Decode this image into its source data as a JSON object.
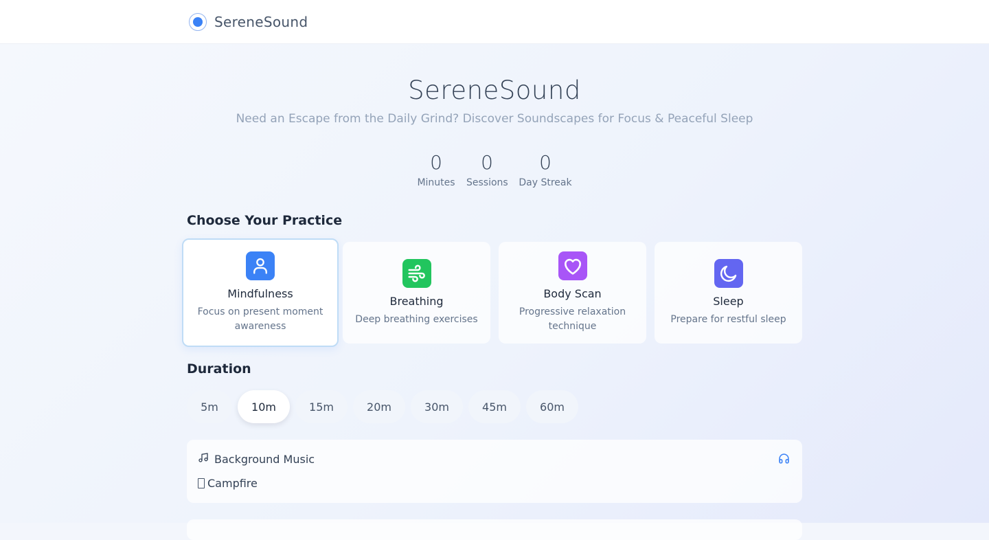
{
  "brand": {
    "name": "SereneSound"
  },
  "hero": {
    "title": "SereneSound",
    "subtitle": "Need an Escape from the Daily Grind? Discover Soundscapes for Focus & Peaceful Sleep"
  },
  "stats": [
    {
      "value": "0",
      "label": "Minutes"
    },
    {
      "value": "0",
      "label": "Sessions"
    },
    {
      "value": "0",
      "label": "Day Streak"
    }
  ],
  "practice": {
    "heading": "Choose Your Practice",
    "selected": "Mindfulness",
    "items": [
      {
        "title": "Mindfulness",
        "desc": "Focus on present moment awareness",
        "icon": "user-icon",
        "color": "#3b82f6"
      },
      {
        "title": "Breathing",
        "desc": "Deep breathing exercises",
        "icon": "wind-icon",
        "color": "#22c55e"
      },
      {
        "title": "Body Scan",
        "desc": "Progressive relaxation technique",
        "icon": "heart-icon",
        "color": "#a855f7"
      },
      {
        "title": "Sleep",
        "desc": "Prepare for restful sleep",
        "icon": "moon-icon",
        "color": "#6366f1"
      }
    ]
  },
  "duration": {
    "heading": "Duration",
    "selected": "10m",
    "options": [
      "5m",
      "10m",
      "15m",
      "20m",
      "30m",
      "45m",
      "60m"
    ]
  },
  "music": {
    "label": "Background Music",
    "track": "Campfire",
    "accent": "#3b82f6"
  }
}
